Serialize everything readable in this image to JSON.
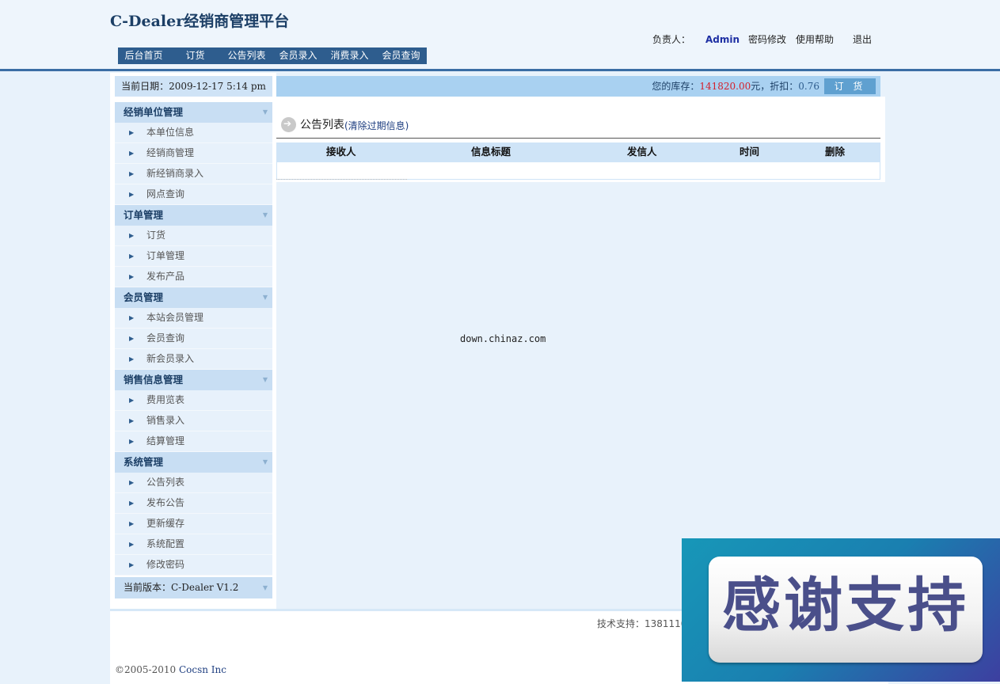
{
  "app": {
    "title": "C-Dealer经销商管理平台"
  },
  "topnav": [
    {
      "label": "后台首页"
    },
    {
      "label": "订货"
    },
    {
      "label": "公告列表"
    },
    {
      "label": "会员录入"
    },
    {
      "label": "消费录入"
    },
    {
      "label": "会员查询"
    }
  ],
  "userbar": {
    "owner_label": "负责人：",
    "owner_name": "Admin",
    "change_password": "密码修改",
    "help": "使用帮助",
    "logout": "退出"
  },
  "sidebar": {
    "date_label": "当前日期：2009-12-17 5:14 pm",
    "groups": [
      {
        "title": "经销单位管理",
        "items": [
          "本单位信息",
          "经销商管理",
          "新经销商录入",
          "网点查询"
        ]
      },
      {
        "title": "订单管理",
        "items": [
          "订货",
          "订单管理",
          "发布产品"
        ]
      },
      {
        "title": "会员管理",
        "items": [
          "本站会员管理",
          "会员查询",
          "新会员录入"
        ]
      },
      {
        "title": "销售信息管理",
        "items": [
          "费用览表",
          "销售录入",
          "结算管理"
        ]
      },
      {
        "title": "系统管理",
        "items": [
          "公告列表",
          "发布公告",
          "更新缓存",
          "系统配置",
          "修改密码"
        ]
      }
    ],
    "version": "当前版本：C-Dealer V1.2"
  },
  "stockbar": {
    "label": "您的库存：",
    "amount": "141820.00",
    "unit_discount": "元，折扣：",
    "discount": "0.76",
    "order_button": "订 货"
  },
  "main": {
    "title": "公告列表",
    "clear_link": "(清除过期信息)",
    "columns": [
      "接收人",
      "信息标题",
      "发信人",
      "时间",
      "删除"
    ],
    "rows": []
  },
  "watermark": "down.chinaz.com",
  "footer": {
    "support": "技术支持：13811100",
    "copyright_prefix": "©2005-2010 ",
    "company": "Cocsn Inc"
  },
  "banner": {
    "text": "感谢支持"
  }
}
